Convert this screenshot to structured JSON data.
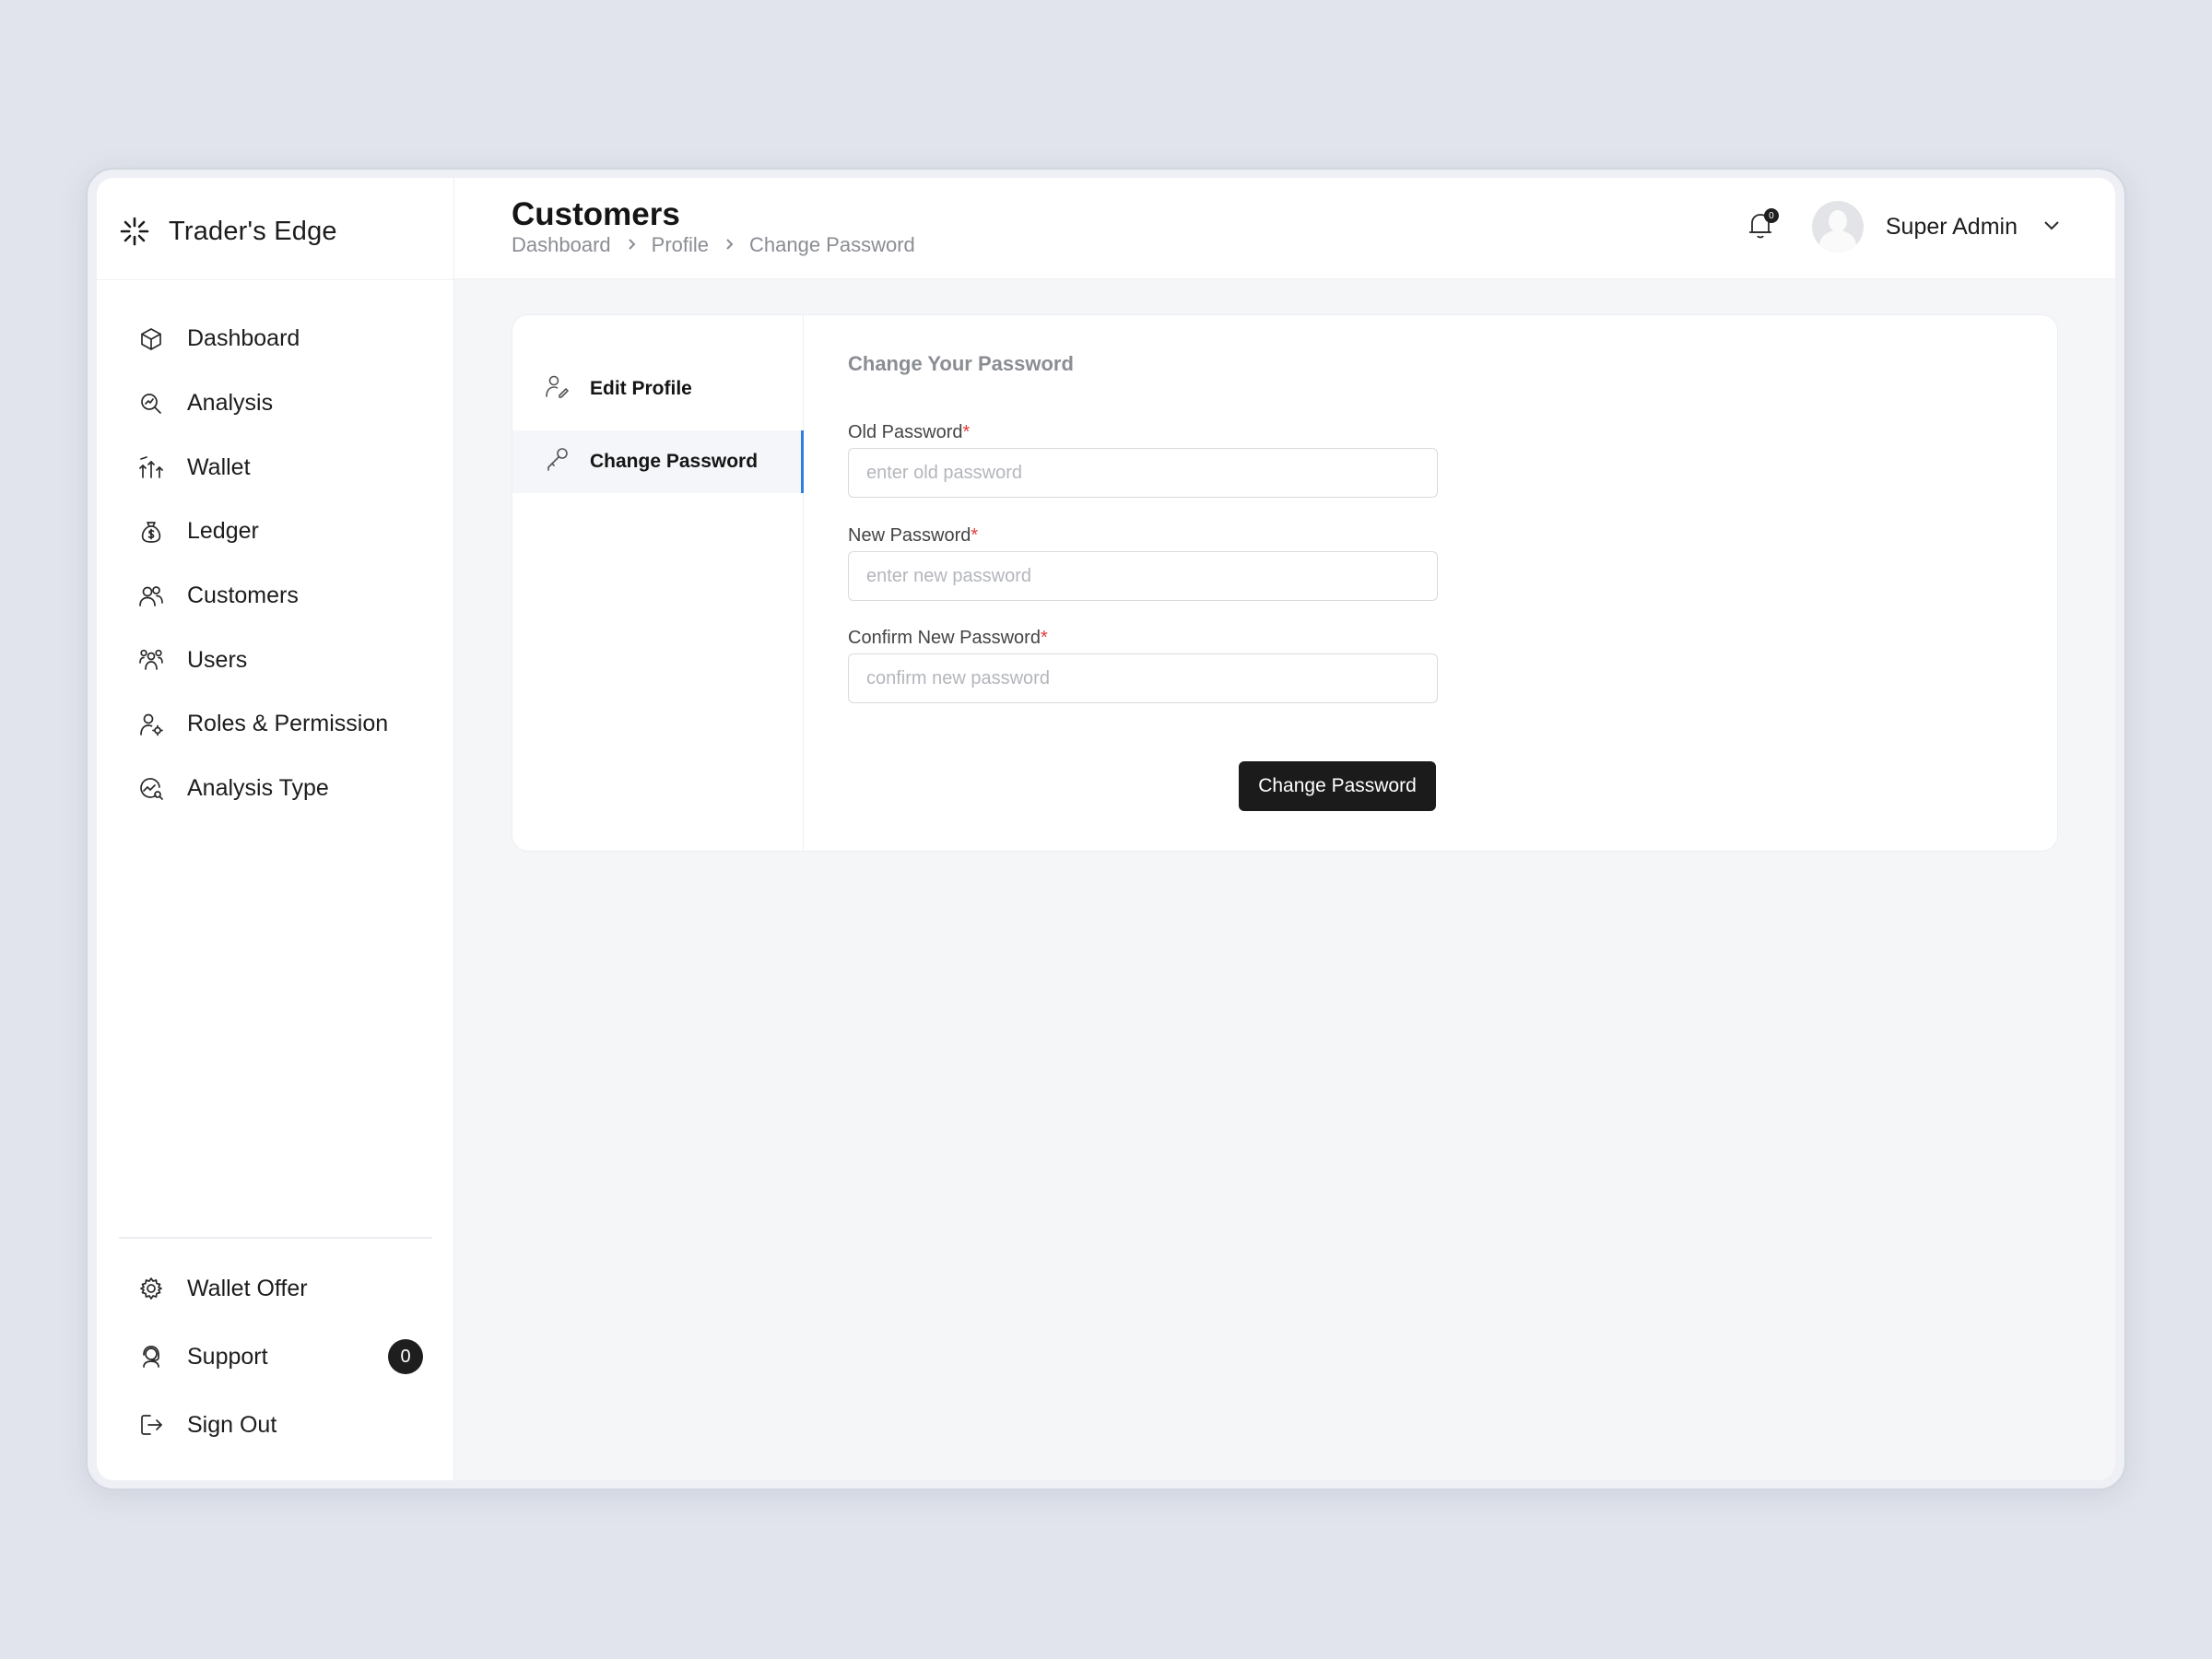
{
  "brand": {
    "name": "Trader's Edge"
  },
  "sidebar": {
    "items": [
      {
        "label": "Dashboard",
        "icon": "cube-icon"
      },
      {
        "label": "Analysis",
        "icon": "search-analysis-icon"
      },
      {
        "label": "Wallet",
        "icon": "wallet-growth-icon"
      },
      {
        "label": "Ledger",
        "icon": "money-bag-icon"
      },
      {
        "label": "Customers",
        "icon": "users-icon"
      },
      {
        "label": "Users",
        "icon": "user-group-icon"
      },
      {
        "label": "Roles & Permission",
        "icon": "user-gear-icon"
      },
      {
        "label": "Analysis Type",
        "icon": "chart-search-icon"
      }
    ],
    "bottom_items": [
      {
        "label": "Wallet Offer",
        "icon": "gear-icon"
      },
      {
        "label": "Support",
        "icon": "support-agent-icon",
        "badge": "0"
      },
      {
        "label": "Sign Out",
        "icon": "sign-out-icon"
      }
    ]
  },
  "header": {
    "title": "Customers",
    "breadcrumb": [
      "Dashboard",
      "Profile",
      "Change Password"
    ],
    "notification_count": "0",
    "user_name": "Super Admin"
  },
  "profile_tabs": {
    "edit_profile": "Edit Profile",
    "change_password": "Change Password"
  },
  "form": {
    "title": "Change Your Password",
    "old_password": {
      "label": "Old Password",
      "required": "*",
      "placeholder": "enter old password",
      "value": ""
    },
    "new_password": {
      "label": "New Password",
      "required": "*",
      "placeholder": "enter new password",
      "value": ""
    },
    "confirm_password": {
      "label": "Confirm New Password",
      "required": "*",
      "placeholder": "confirm new password",
      "value": ""
    },
    "submit_label": "Change Password"
  },
  "colors": {
    "accent": "#2f7de1",
    "button": "#1b1b1b",
    "background": "#e1e4ec",
    "required": "#e23b3b"
  }
}
